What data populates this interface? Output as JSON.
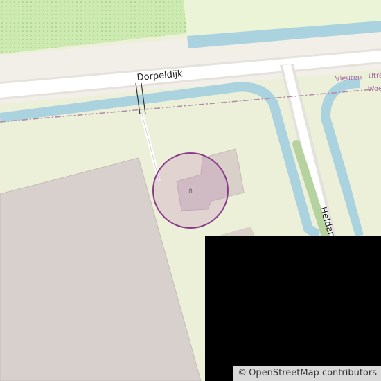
{
  "map": {
    "streets": {
      "dorpeldijk": "Dorpeldijk",
      "heldam": "Heldam"
    },
    "place_labels": {
      "vleuten": "Vleuten",
      "utrecht": "Utre",
      "woerden": "Woe"
    },
    "house_number": "8",
    "marker": {
      "type": "location-circle",
      "color": "#8a3a8a"
    },
    "colors": {
      "land": "#edf0d9",
      "farmland": "#ecf4d8",
      "meadow": "#cdebb0",
      "water": "#aad3df",
      "road": "#ffffff",
      "road_casing": "#e5e1dc",
      "building": "#d9d0c9",
      "industrial": "#d7d0cd",
      "boundary": "#b08aa9",
      "cycleway_green": "#b5d29f"
    }
  },
  "attribution": {
    "symbol": "©",
    "text": "OpenStreetMap contributors"
  }
}
